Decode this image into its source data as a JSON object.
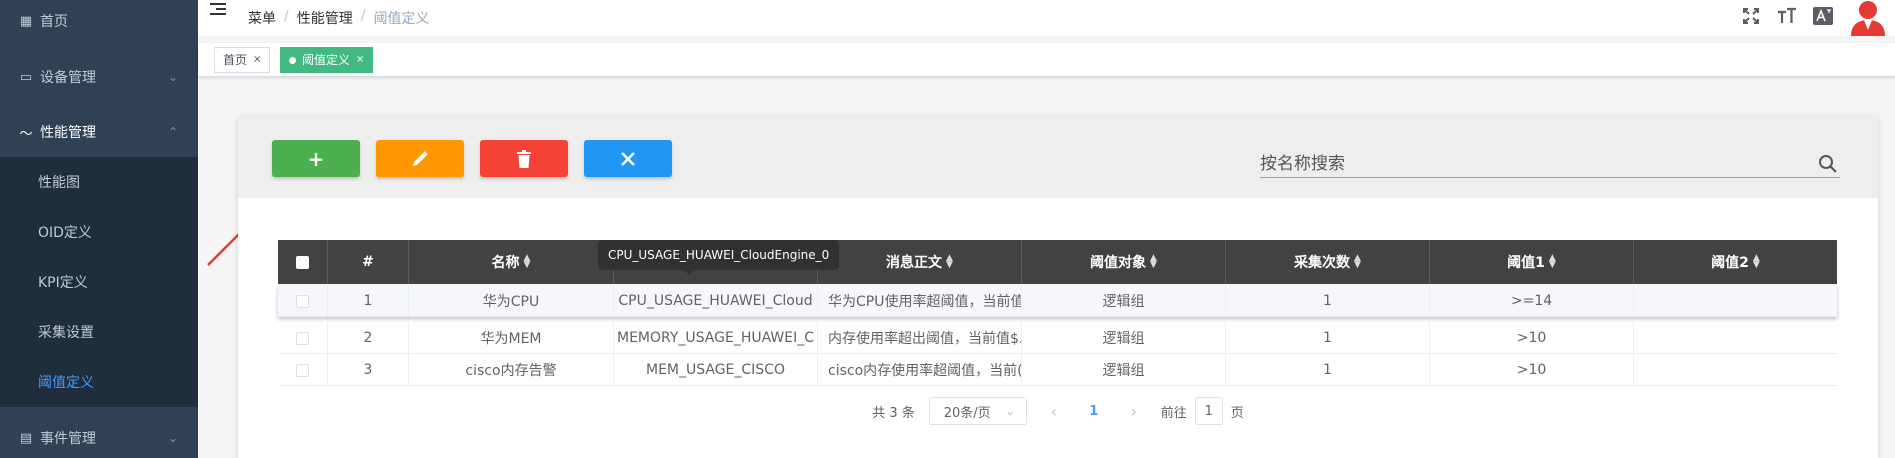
{
  "sidebar": {
    "items": [
      {
        "label": "首页",
        "icon": "dashboard-icon"
      },
      {
        "label": "设备管理",
        "icon": "laptop-icon"
      },
      {
        "label": "性能管理",
        "icon": "trend-icon"
      },
      {
        "label": "事件管理",
        "icon": "calendar-icon"
      }
    ],
    "submenu": [
      {
        "label": "性能图"
      },
      {
        "label": "OID定义"
      },
      {
        "label": "KPI定义"
      },
      {
        "label": "采集设置"
      },
      {
        "label": "阈值定义",
        "active": true
      }
    ]
  },
  "navbar": {
    "breadcrumb": [
      "菜单",
      "性能管理",
      "阈值定义"
    ]
  },
  "tags": [
    {
      "label": "首页"
    },
    {
      "label": "阈值定义",
      "active": true
    }
  ],
  "toolbar": {
    "add": "+",
    "search_placeholder": "按名称搜索"
  },
  "table": {
    "headers": [
      "#",
      "名称",
      "",
      "消息正文",
      "阈值对象",
      "采集次数",
      "阈值1",
      "阈值2"
    ],
    "rows": [
      {
        "index": "1",
        "name": "华为CPU",
        "metric": "CPU_USAGE_HUAWEI_Cloud",
        "message": "华为CPU使用率超阈值，当前值",
        "object": "逻辑组",
        "count": "1",
        "t1": ">=14",
        "t2": ""
      },
      {
        "index": "2",
        "name": "华为MEM",
        "metric": "MEMORY_USAGE_HUAWEI_C",
        "message": "内存使用率超出阈值，当前值$.",
        "object": "逻辑组",
        "count": "1",
        "t1": ">10",
        "t2": ""
      },
      {
        "index": "3",
        "name": "cisco内存告警",
        "metric": "MEM_USAGE_CISCO",
        "message": "cisco内存使用率超阈值，当前(",
        "object": "逻辑组",
        "count": "1",
        "t1": ">10",
        "t2": ""
      }
    ],
    "tooltip": "CPU_USAGE_HUAWEI_CloudEngine_0"
  },
  "pagination": {
    "total": "共 3 条",
    "page_size": "20条/页",
    "current": "1",
    "goto_prefix": "前往",
    "goto_value": "1",
    "goto_suffix": "页"
  },
  "colors": {
    "sidebar_bg": "#304156",
    "submenu_bg": "#1f2d3d",
    "active_menu": "#409eff",
    "tag_active": "#42b983",
    "btn_add": "#4caf50",
    "btn_edit": "#ff9800",
    "btn_delete": "#f44336",
    "btn_close": "#2196f3",
    "table_header": "#424242"
  }
}
